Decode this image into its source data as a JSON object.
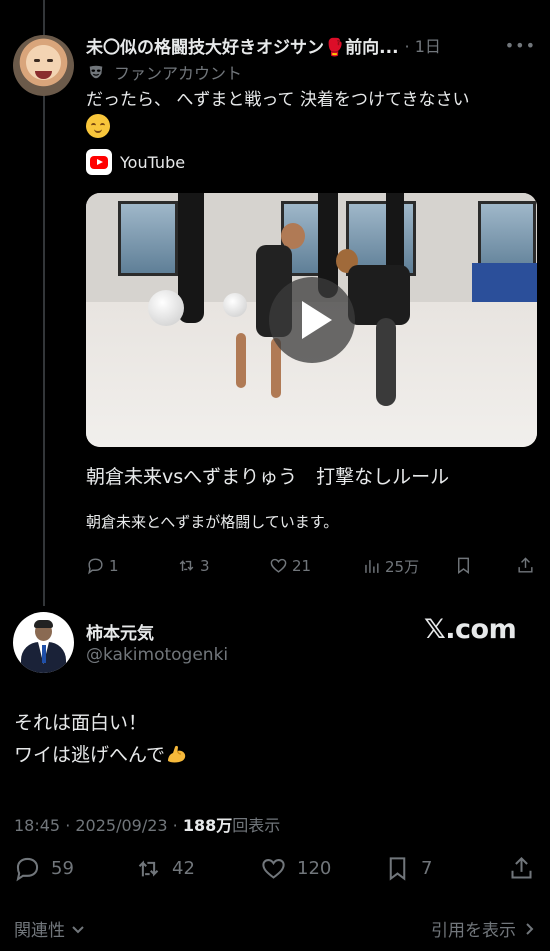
{
  "reply": {
    "author_name": "未〇似の格闘技大好きオジサン🥊前向...",
    "time": "1日",
    "more": "•••",
    "sub_label": "ファンアカウント",
    "text": "だったら、 へずまと戦って 決着をつけてきなさい",
    "embed": {
      "source": "YouTube",
      "title": "朝倉未来vsへずまりゅう　打撃なしルール",
      "description": "朝倉未来とへずまが格闘しています。"
    },
    "actions": {
      "replies": "1",
      "reposts": "3",
      "likes": "21",
      "views": "25万"
    }
  },
  "main": {
    "author_name": "柿本元気",
    "handle": "@kakimotogenki",
    "watermark": "𝕏.com",
    "text_line1": "それは面白い！",
    "text_line2": "ワイは逃げへんで",
    "meta": {
      "time": "18:45",
      "sep": " · ",
      "date": "2025/09/23",
      "dot": " · ",
      "views": "188万",
      "views_suffix": "回表示"
    },
    "actions": {
      "replies": "59",
      "reposts": "42",
      "likes": "120",
      "bookmarks": "7"
    }
  },
  "footer": {
    "left": "関連性",
    "right": "引用を表示"
  }
}
